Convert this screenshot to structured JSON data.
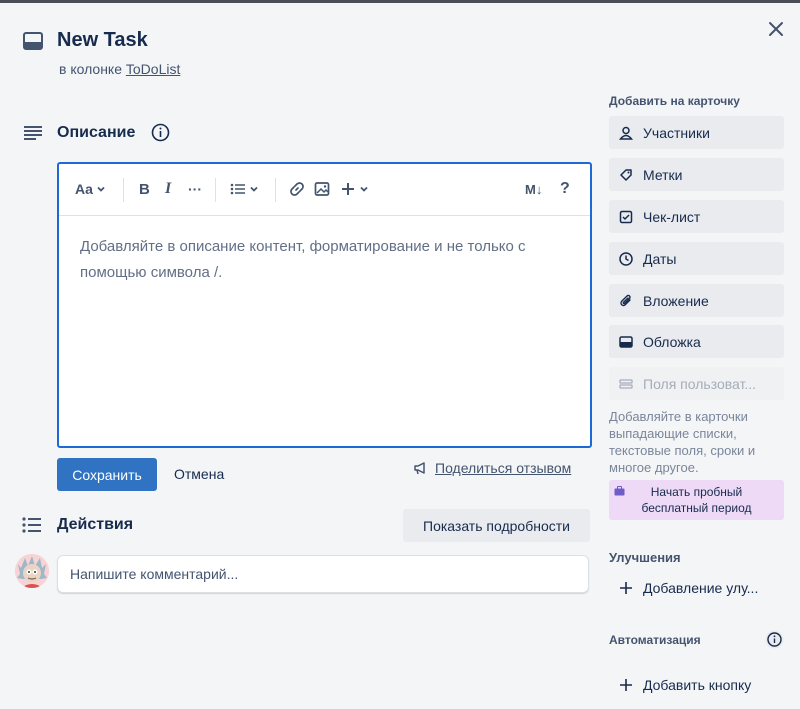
{
  "card": {
    "title": "New Task",
    "column_prefix": "в колонке",
    "column_name": "ToDoList"
  },
  "description": {
    "title": "Описание",
    "toolbar": {
      "text_style": "Aa",
      "bold": "B",
      "italic": "I",
      "more": "···",
      "markdown": "M↓",
      "help": "?"
    },
    "placeholder": "Добавляйте в описание контент, форматирование и не только с помощью символа /.",
    "save_label": "Сохранить",
    "cancel_label": "Отмена",
    "feedback_label": "Поделиться отзывом"
  },
  "activity": {
    "title": "Действия",
    "show_details_label": "Показать подробности",
    "comment_placeholder": "Напишите комментарий..."
  },
  "sidebar": {
    "add_to_card_title": "Добавить на карточку",
    "buttons": [
      {
        "label": "Участники",
        "icon": "person-icon"
      },
      {
        "label": "Метки",
        "icon": "tag-icon"
      },
      {
        "label": "Чек-лист",
        "icon": "checkbox-icon"
      },
      {
        "label": "Даты",
        "icon": "clock-icon"
      },
      {
        "label": "Вложение",
        "icon": "paperclip-icon"
      },
      {
        "label": "Обложка",
        "icon": "card-cover-icon"
      },
      {
        "label": "Поля пользоват...",
        "icon": "custom-fields-icon",
        "disabled": true
      }
    ],
    "custom_fields_note": "Добавляйте в карточки выпадающие списки, текстовые поля, сроки и многое другое.",
    "trial_label_line1": "Начать пробный",
    "trial_label_line2": "бесплатный период",
    "powerups_title": "Улучшения",
    "add_powerup_label": "Добавление улу...",
    "automation_title": "Автоматизация",
    "add_button_label": "Добавить кнопку"
  },
  "colors": {
    "primary": "#2f73c2",
    "editor_border": "#1d6ad6",
    "trial_bg": "#eed9f7"
  }
}
